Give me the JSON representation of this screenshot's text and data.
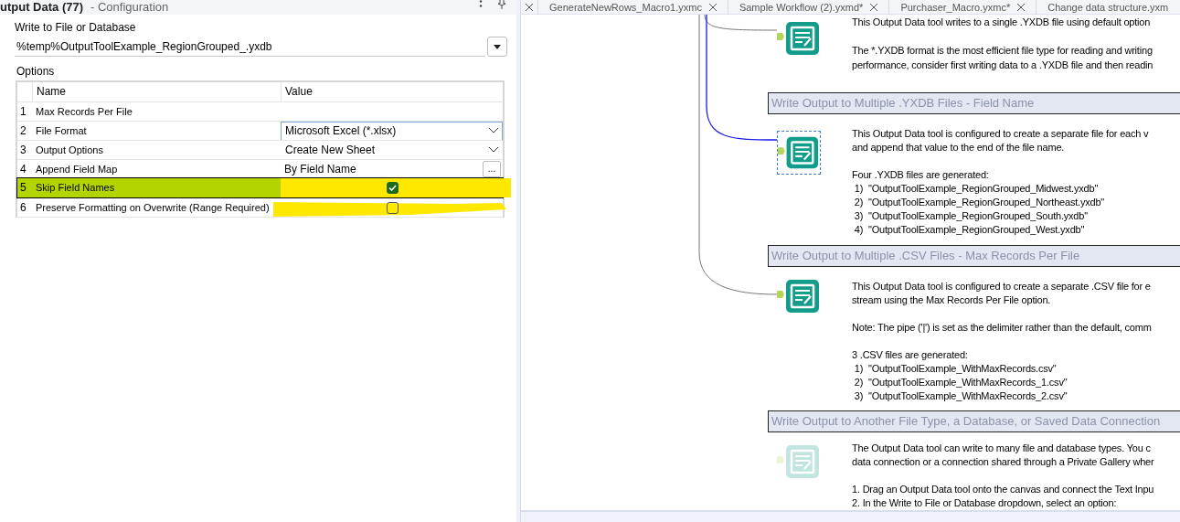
{
  "config_panel": {
    "title": "utput Data (77)",
    "subtitle": "- Configuration",
    "file_label": "Write to File or Database",
    "file_value": "%temp%OutputToolExample_RegionGrouped_.yxdb",
    "options_label": "Options",
    "columns": [
      "Name",
      "Value"
    ],
    "rows": [
      {
        "index": "1",
        "name": "Max Records Per File",
        "kind": "empty",
        "selected": false,
        "highlighted": false
      },
      {
        "index": "2",
        "name": "File Format",
        "kind": "dropdown",
        "value": "Microsoft Excel (*.xlsx)",
        "selected": false,
        "highlighted": false
      },
      {
        "index": "3",
        "name": "Output Options",
        "kind": "dropdown",
        "value": "Create New Sheet",
        "selected": false,
        "highlighted": false
      },
      {
        "index": "4",
        "name": "Append Field Map",
        "kind": "ellipsis",
        "value": "By Field Name",
        "button": "...",
        "selected": false,
        "highlighted": false
      },
      {
        "index": "5",
        "name": "Skip Field Names",
        "kind": "checkbox",
        "checked": true,
        "selected": true,
        "highlighted": true
      },
      {
        "index": "6",
        "name": "Preserve Formatting on Overwrite (Range Required)",
        "kind": "checkbox",
        "checked": false,
        "selected": false,
        "highlighted": true
      }
    ]
  },
  "tabs": [
    {
      "label": "GenerateNewRows_Macro1.yxmc",
      "selected": false
    },
    {
      "label": "Sample Workflow (2).yxmd*",
      "selected": false
    },
    {
      "label": "Purchaser_Macro.yxmc*",
      "selected": false
    },
    {
      "label": "Change data structure.yxm",
      "selected": false
    }
  ],
  "canvas": {
    "sections": [
      {
        "paragraphs": [
          [
            "This Output Data tool writes to a single .YXDB file using default option"
          ],
          [
            "The *.YXDB format is the most efficient file type for reading and writing",
            "performance, consider first writing data to a .YXDB file and then readin"
          ]
        ],
        "tool": {
          "selected": false,
          "disabled": false
        }
      },
      {
        "header": "Write Output to Multiple .YXDB Files - Field Name",
        "paragraphs": [
          [
            "This Output Data tool is configured to create a separate file for each v",
            "and append that value to the end of the file name."
          ],
          [
            "Four .YXDB files are generated:",
            " 1)  \"OutputToolExample_RegionGrouped_Midwest.yxdb\"",
            " 2)  \"OutputToolExample_RegionGrouped_Northeast.yxdb\"",
            " 3)  \"OutputToolExample_RegionGrouped_South.yxdb\"",
            " 4)  \"OutputToolExample_RegionGrouped_West.yxdb\""
          ]
        ],
        "tool": {
          "selected": true,
          "disabled": false
        }
      },
      {
        "header": "Write Output to Multiple .CSV Files - Max Records Per File",
        "paragraphs": [
          [
            "This Output Data tool is configured to create a separate .CSV file for e",
            "stream using the Max Records Per File option."
          ],
          [
            "Note: The pipe ('|') is set as the delimiter rather than the default, comm"
          ],
          [
            "3 .CSV files are generated:",
            " 1)  \"OutputToolExample_WithMaxRecords.csv\"",
            " 2)  \"OutputToolExample_WithMaxRecords_1.csv\"",
            " 3)  \"OutputToolExample_WithMaxRecords_2.csv\""
          ]
        ],
        "tool": {
          "selected": false,
          "disabled": false
        }
      },
      {
        "header": "Write Output to Another File Type, a Database, or Saved Data Connection",
        "paragraphs": [
          [
            "The Output Data tool can write to many file and database types. You c",
            "data connection or a connection shared through a Private Gallery wher"
          ],
          [
            "1. Drag an Output Data tool onto the canvas and connect the Text Inpu",
            "2. In the Write to File or Database dropdown, select an option:"
          ]
        ],
        "tool": {
          "selected": false,
          "disabled": true
        }
      }
    ]
  }
}
